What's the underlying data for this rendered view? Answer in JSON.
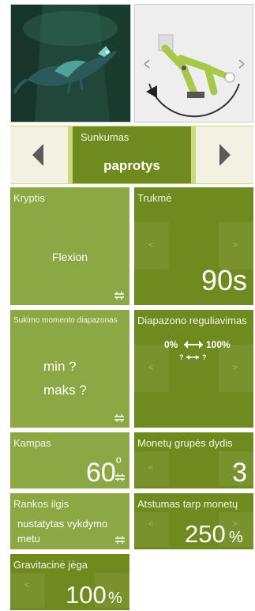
{
  "difficulty": {
    "label": "Sunkumas",
    "value": "paprotys",
    "prev_icon": "triangle-left-icon",
    "next_icon": "triangle-right-icon"
  },
  "tiles": {
    "direction": {
      "title": "Kryptis",
      "value": "Flexion"
    },
    "duration": {
      "title": "Trukmė",
      "value": "90s",
      "left": "<",
      "right": ">"
    },
    "torque_range": {
      "title": "Sukimo momento diapazonas",
      "min": "min ?",
      "max": "maks ?"
    },
    "range_adjust": {
      "title": "Diapazono reguliavimas",
      "line1_left": "0%",
      "line1_right": "100%",
      "line2_left": "?",
      "line2_right": "?",
      "left": "<",
      "right": ">"
    },
    "angle": {
      "title": "Kampas",
      "value": "60",
      "unit": "º"
    },
    "coin_group": {
      "title": "Monetų grupės dydis",
      "value": "3",
      "left": "<",
      "right": ">"
    },
    "arm_length": {
      "title": "Rankos ilgis",
      "line1": "nustatytas vykdymo",
      "line2": "metu"
    },
    "coin_distance": {
      "title": "Atstumas tarp monetų",
      "value": "250",
      "unit": "%",
      "left": "<",
      "right": ">"
    },
    "gravity": {
      "title": "Gravitacinė jėga",
      "value": "100",
      "unit": "%",
      "left": "<",
      "right": ">"
    }
  },
  "colors": {
    "tile_light": "#8ca844",
    "tile_dark": "#6f8a1e",
    "nav_button_bg": "#f3f1e1"
  }
}
